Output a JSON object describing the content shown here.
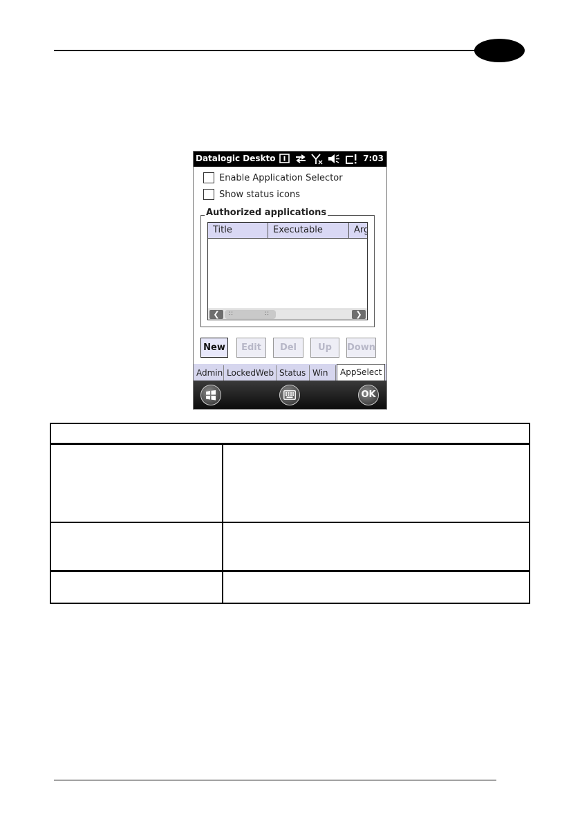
{
  "page": {
    "chapter_badge": ""
  },
  "device": {
    "status_bar": {
      "title": "Datalogic Deskto",
      "time": "7:03",
      "icons": [
        "notification-icon",
        "sync-arrows-icon",
        "no-signal-icon",
        "speaker-muted-icon",
        "battery-alert-icon"
      ]
    },
    "checkboxes": [
      {
        "label": "Enable Application Selector",
        "checked": false
      },
      {
        "label": "Show status icons",
        "checked": false
      }
    ],
    "group_title": "Authorized applications",
    "list_columns": [
      "Title",
      "Executable",
      "Arg"
    ],
    "list_rows": [],
    "buttons": [
      {
        "label": "New",
        "enabled": true
      },
      {
        "label": "Edit",
        "enabled": false
      },
      {
        "label": "Del",
        "enabled": false
      },
      {
        "label": "Up",
        "enabled": false
      },
      {
        "label": "Down",
        "enabled": false
      }
    ],
    "tabs": [
      {
        "label": "Admin",
        "selected": false
      },
      {
        "label": "LockedWeb",
        "selected": false
      },
      {
        "label": "Status",
        "selected": false
      },
      {
        "label": "Win",
        "selected": false
      },
      {
        "label": "AppSelect",
        "selected": true
      }
    ],
    "softkeys": {
      "ok_label": "OK"
    },
    "colors": {
      "header_bg": "#d9d8f4",
      "tab_bg": "#d6d6ee",
      "status_bar": "#000000"
    }
  },
  "table": {
    "header": "",
    "rows": [
      {
        "left": "",
        "right": ""
      },
      {
        "left": "",
        "right": ""
      },
      {
        "left": "",
        "right": ""
      }
    ]
  }
}
